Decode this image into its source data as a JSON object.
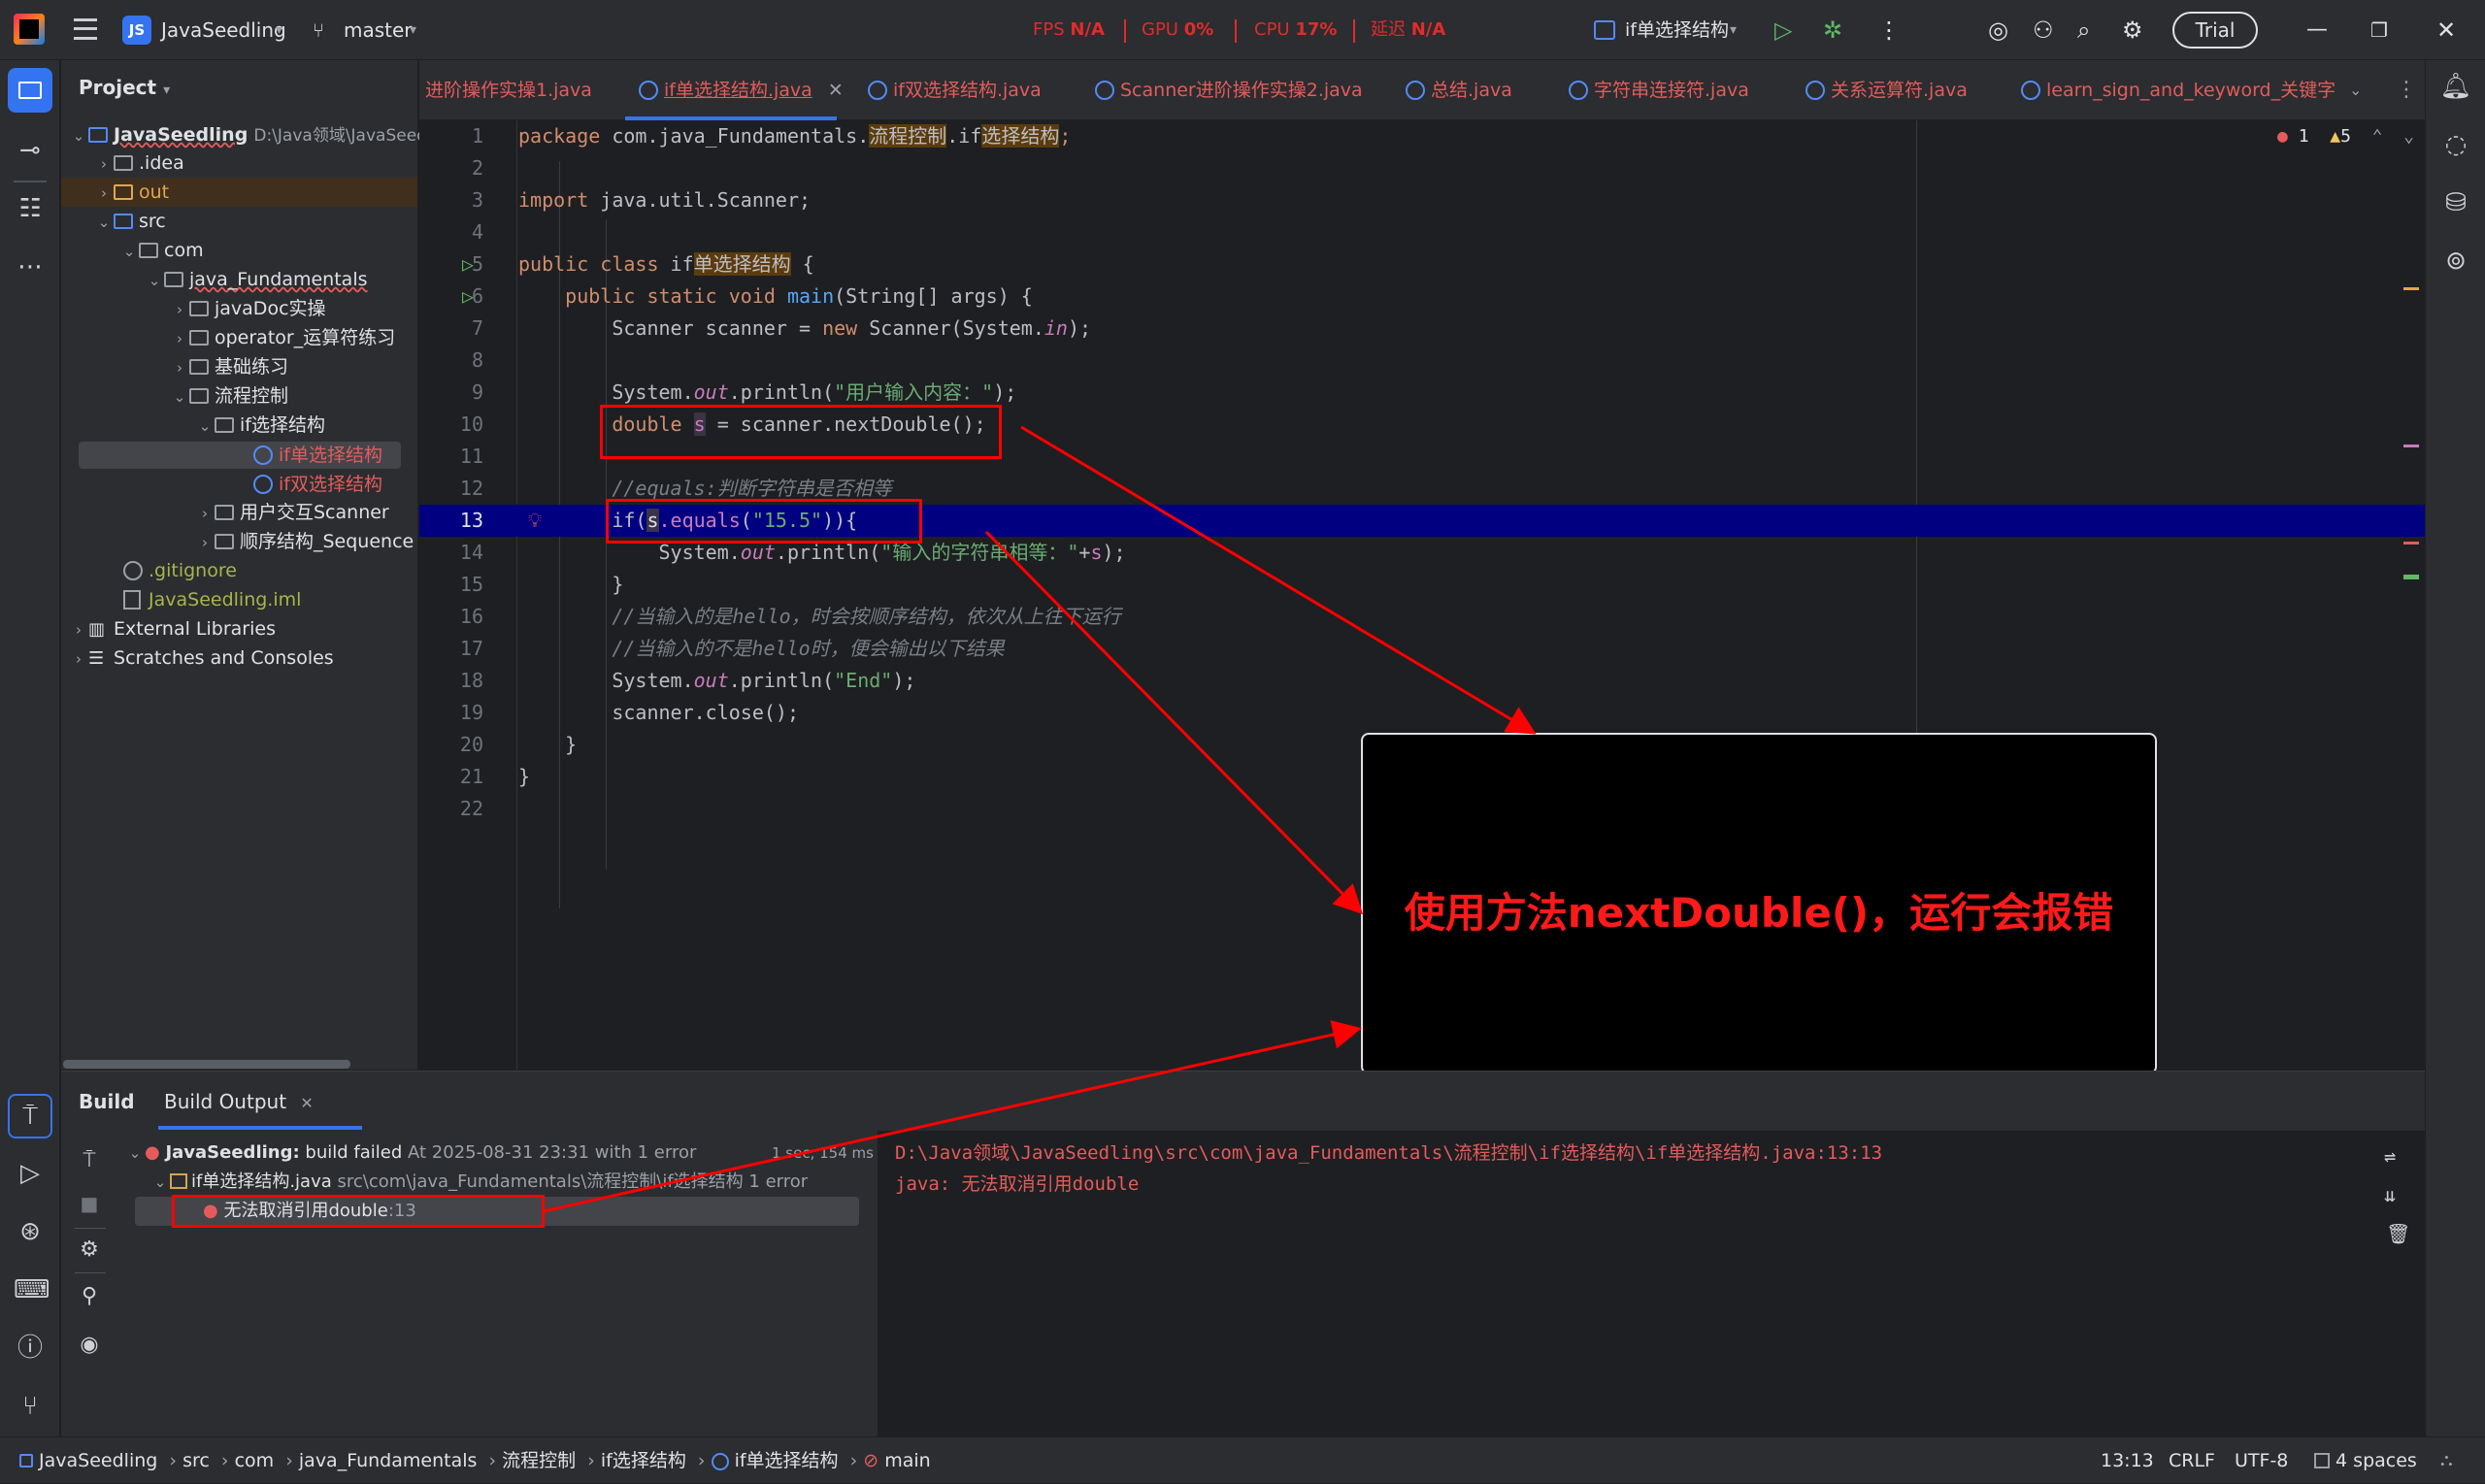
{
  "title_bar": {
    "project_badge": "JS",
    "project_name": "JavaSeedling",
    "branch": "master",
    "metrics": [
      {
        "label": "FPS",
        "value": "N/A"
      },
      {
        "label": "GPU",
        "value": "0%"
      },
      {
        "label": "CPU",
        "value": "17%"
      },
      {
        "label": "延迟",
        "value": "N/A"
      }
    ],
    "run_config": "if单选择结构",
    "trial_label": "Trial"
  },
  "project_panel": {
    "title": "Project",
    "items": [
      {
        "label": "JavaSeedling",
        "extra": "D:\\Java领域\\JavaSeed"
      },
      {
        "label": ".idea"
      },
      {
        "label": "out"
      },
      {
        "label": "src"
      },
      {
        "label": "com"
      },
      {
        "label": "java_Fundamentals"
      },
      {
        "label": "javaDoc实操"
      },
      {
        "label": "operator_运算符练习"
      },
      {
        "label": "基础练习"
      },
      {
        "label": "流程控制"
      },
      {
        "label": "if选择结构"
      },
      {
        "label": "if单选择结构"
      },
      {
        "label": "if双选择结构"
      },
      {
        "label": "用户交互Scanner"
      },
      {
        "label": "顺序结构_Sequence"
      },
      {
        "label": ".gitignore"
      },
      {
        "label": "JavaSeedling.iml"
      },
      {
        "label": "External Libraries"
      },
      {
        "label": "Scratches and Consoles"
      }
    ]
  },
  "tabs": [
    {
      "label": "进阶操作实操1.java"
    },
    {
      "label": "if单选择结构.java"
    },
    {
      "label": "if双选择结构.java"
    },
    {
      "label": "Scanner进阶操作实操2.java"
    },
    {
      "label": "总结.java"
    },
    {
      "label": "字符串连接符.java"
    },
    {
      "label": "关系运算符.java"
    },
    {
      "label": "learn_sign_and_keyword_关键字"
    }
  ],
  "inspections": {
    "errors": "1",
    "warnings": "5"
  },
  "code": {
    "line_numbers": [
      "1",
      "2",
      "3",
      "4",
      "5",
      "6",
      "7",
      "8",
      "9",
      "10",
      "11",
      "12",
      "13",
      "14",
      "15",
      "16",
      "17",
      "18",
      "19",
      "20",
      "21",
      "22"
    ],
    "l1": {
      "kw": "package",
      "pkg": " com.java_Fundamentals.",
      "h1": "流程控制",
      "dot": ".if",
      "h2": "选择结构",
      "end": ";"
    },
    "l3": {
      "kw": "import",
      "rest": " java.util.Scanner;"
    },
    "l5": {
      "kw": "public class",
      "name1": " if",
      "name2": "单选择结构",
      "rest": " {"
    },
    "l6": {
      "kw": "public static void",
      "fn": " main",
      "rest": "(String[] args) {"
    },
    "l7": {
      "a": "Scanner scanner = ",
      "kw": "new",
      "b": " Scanner(System.",
      "fld": "in",
      "c": ");"
    },
    "l9": {
      "a": "System.",
      "fld": "out",
      "b": ".println(",
      "str": "\"用户输入内容：\"",
      "c": ");"
    },
    "l10": {
      "kw": "double",
      "sp": " ",
      "var": "s",
      "rest": " = scanner.nextDouble();"
    },
    "l12": {
      "cm": "//equals:判断字符串是否相等"
    },
    "l13": {
      "a": "if(",
      "var": "s",
      "fn": ".equals",
      "b": "(",
      "str": "\"15.5\"",
      "c": ")){"
    },
    "l14": {
      "a": "System.",
      "fld": "out",
      "b": ".println(",
      "str": "\"输入的字符串相等：\"",
      "c": "+",
      "var": "s",
      "d": ");"
    },
    "l15": {
      "a": "}"
    },
    "l16": {
      "cm": "//当输入的是hello，时会按顺序结构，依次从上往下运行"
    },
    "l17": {
      "cm": "//当输入的不是hello时，便会输出以下结果"
    },
    "l18": {
      "a": "System.",
      "fld": "out",
      "b": ".println(",
      "str": "\"End\"",
      "c": ");"
    },
    "l19": {
      "a": "scanner.close();"
    },
    "l20": {
      "a": "}"
    },
    "l21": {
      "a": "}"
    }
  },
  "callout": {
    "text": "使用方法nextDouble()，运行会报错"
  },
  "build": {
    "tab_build": "Build",
    "tab_output": "Build Output",
    "root_label": "JavaSeedling:",
    "root_status": "build failed",
    "root_time": "At 2025-08-31 23:31 with 1 error",
    "duration": "1 sec, 154 ms",
    "file_label": "if单选择结构.java",
    "file_path": "src\\com\\java_Fundamentals\\流程控制\\if选择结构",
    "file_count": "1 error",
    "error_label": "无法取消引用double",
    "error_line": ":13",
    "output_path": "D:\\Java领域\\JavaSeedling\\src\\com\\java_Fundamentals\\流程控制\\if选择结构\\if单选择结构.java:13:13",
    "output_msg": "java: 无法取消引用double"
  },
  "status_bar": {
    "breadcrumbs": [
      "JavaSeedling",
      "src",
      "com",
      "java_Fundamentals",
      "流程控制",
      "if选择结构",
      "if单选择结构",
      "main"
    ],
    "position": "13:13",
    "line_sep": "CRLF",
    "encoding": "UTF-8",
    "indent": "4 spaces"
  },
  "colors": {
    "accent": "#3574f0",
    "error": "#e55b5b",
    "annotation_red": "#ff0000",
    "selection": "#000080"
  }
}
